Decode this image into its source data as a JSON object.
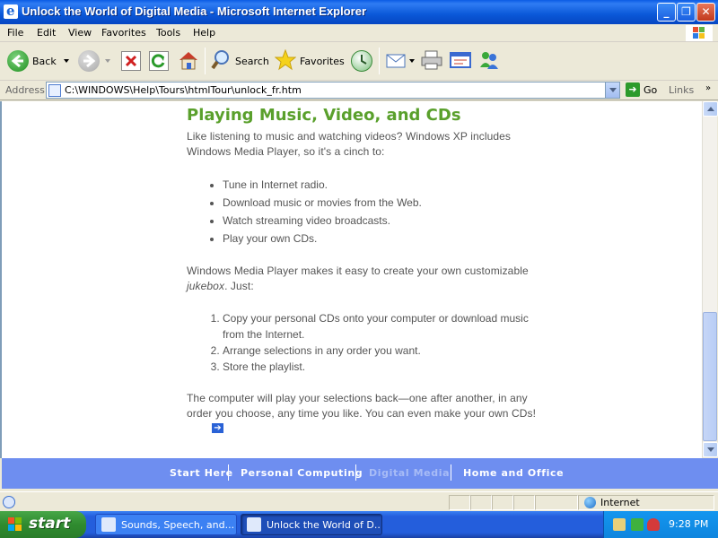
{
  "window": {
    "title": "Unlock the World of Digital Media - Microsoft Internet Explorer",
    "controls": {
      "minimize": "_",
      "maximize": "❐",
      "close": "✕"
    }
  },
  "menubar": {
    "items": [
      "File",
      "Edit",
      "View",
      "Favorites",
      "Tools",
      "Help"
    ]
  },
  "toolbar": {
    "back_label": "Back",
    "search_label": "Search",
    "favorites_label": "Favorites"
  },
  "addressbar": {
    "label": "Address",
    "url": "C:\\WINDOWS\\Help\\Tours\\htmlTour\\unlock_fr.htm",
    "go_label": "Go",
    "links_label": "Links"
  },
  "page": {
    "heading": "Playing Music, Video, and CDs",
    "intro": "Like listening to music and watching videos? Windows XP includes Windows Media Player, so it's a cinch to:",
    "bullets": [
      "Tune in Internet radio.",
      "Download music or movies from the Web.",
      "Watch streaming video broadcasts.",
      "Play your own CDs."
    ],
    "jukebox_before": "Windows Media Player makes it easy to create your own customizable ",
    "jukebox_em": "jukebox",
    "jukebox_after": ". Just:",
    "steps": [
      "Copy your personal CDs onto your computer or download music from the Internet.",
      "Arrange selections in any order you want.",
      "Store the playlist."
    ],
    "closing": "The computer will play your selections back—one after another, in any order you choose, any time you like. You can even make your own CDs!",
    "next_arrow": "➔"
  },
  "navband": {
    "links": [
      "Start Here",
      "Personal Computing",
      "Digital Media",
      "Home and Office"
    ],
    "current": "Digital Media"
  },
  "statusbar": {
    "zone": "Internet"
  },
  "taskbar": {
    "start_label": "start",
    "tasks": [
      "Sounds, Speech, and...",
      "Unlock the World of D..."
    ],
    "active_task": "Unlock the World of D...",
    "clock": "9:28 PM"
  }
}
